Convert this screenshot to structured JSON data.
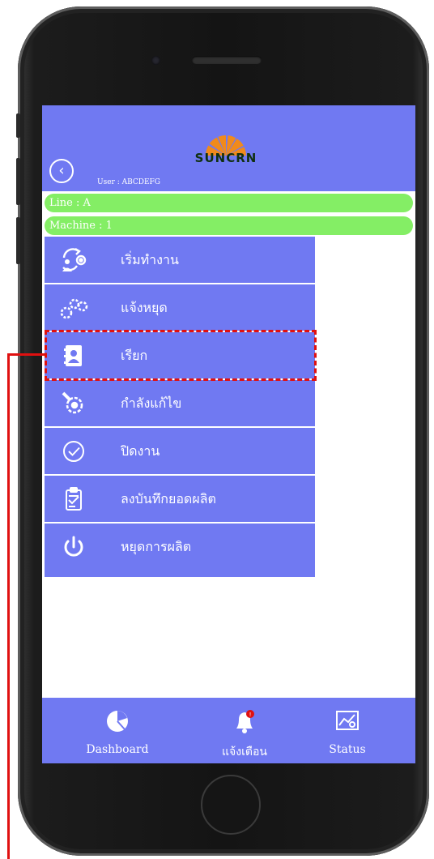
{
  "app": {
    "brand": "SUNCRN",
    "user_label": "User  :  ABCDEFG"
  },
  "info": {
    "line": "Line  :  A",
    "machine": "Machine  :  1"
  },
  "menu": {
    "items": [
      {
        "label": "เริ่มทำงาน",
        "icon": "start-work-icon"
      },
      {
        "label": "แจ้งหยุด",
        "icon": "gears-icon"
      },
      {
        "label": "เรียก",
        "icon": "contact-book-icon"
      },
      {
        "label": "กำลังแก้ไข",
        "icon": "repair-gear-icon"
      },
      {
        "label": "ปิดงาน",
        "icon": "check-circle-icon"
      },
      {
        "label": "ลงบันทึกยอดผลิต",
        "icon": "clipboard-check-icon"
      },
      {
        "label": "หยุดการผลิต",
        "icon": "power-icon"
      }
    ]
  },
  "nav": {
    "dashboard": "Dashboard",
    "alerts": "แจ้งเตือน",
    "status": "Status"
  },
  "colors": {
    "primary": "#7079f2",
    "info_bar": "#84ee65",
    "highlight": "#e01010",
    "logo_orange": "#f08a1c"
  }
}
